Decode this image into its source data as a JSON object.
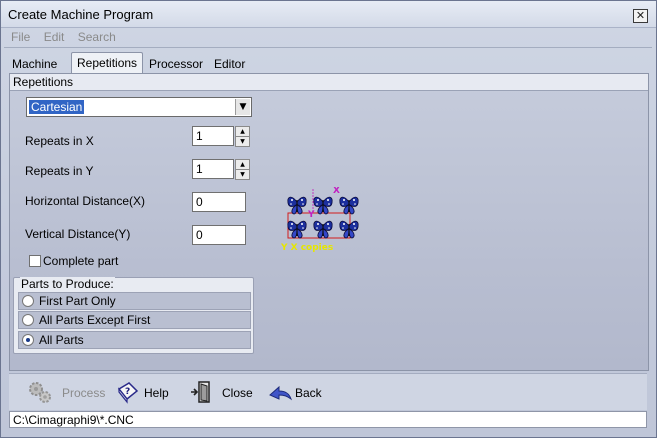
{
  "window": {
    "title": "Create Machine Program",
    "close_glyph": "✕"
  },
  "menu": [
    "File",
    "Edit",
    "Search"
  ],
  "tabs": [
    "Machine",
    "Repetitions",
    "Processor",
    "Editor"
  ],
  "active_tab": "Repetitions",
  "panel": {
    "header": "Repetitions"
  },
  "mode_select": {
    "value": "Cartesian"
  },
  "fields": {
    "repeats_x": {
      "label": "Repeats in X",
      "value": "1"
    },
    "repeats_y": {
      "label": "Repeats in Y",
      "value": "1"
    },
    "horizontal_distance": {
      "label": "Horizontal Distance(X)",
      "value": "0"
    },
    "vertical_distance": {
      "label": "Vertical Distance(Y)",
      "value": "0"
    }
  },
  "complete_part": {
    "label": "Complete part",
    "checked": false
  },
  "parts_group": {
    "legend": "Parts to Produce:",
    "options": [
      {
        "label": "First Part Only",
        "selected": false
      },
      {
        "label": "All Parts Except First",
        "selected": false
      },
      {
        "label": "All Parts",
        "selected": true
      }
    ]
  },
  "preview": {
    "x_label": "X",
    "y_label": "Y",
    "caption": "Y X copies"
  },
  "buttons": {
    "process": "Process",
    "help": "Help",
    "close": "Close",
    "back": "Back"
  },
  "status_path": "C:\\Cimagraphi9\\*.CNC"
}
